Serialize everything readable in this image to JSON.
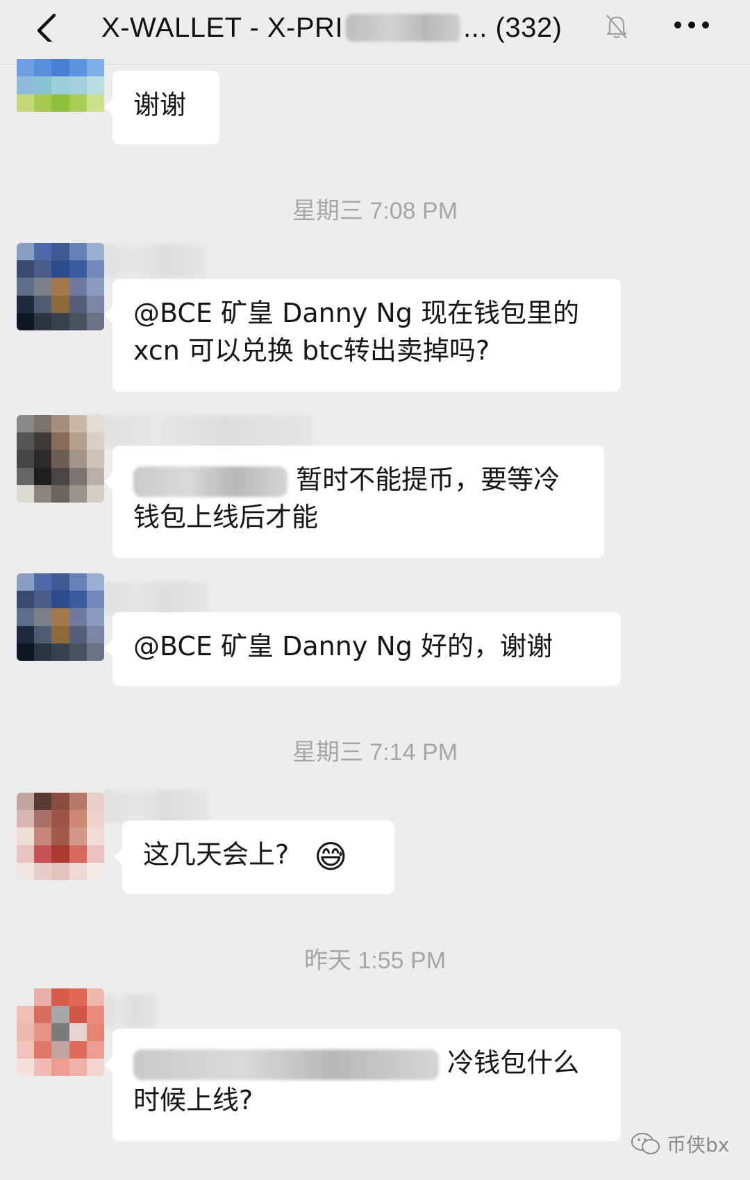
{
  "header": {
    "title_start": "X-WALLET - X-PRI",
    "title_end": "... (332)",
    "icons": {
      "back": "back-chevron-icon",
      "mute": "muted-bell-icon",
      "more": "more-dots-icon"
    }
  },
  "messages": [
    {
      "text": "谢谢"
    },
    {
      "text": "@BCE 矿皇 Danny Ng 现在钱包里的 xcn 可以兑换 btc转出卖掉吗?"
    },
    {
      "text_end": "暂时不能提币，要等冷钱包上线后才能"
    },
    {
      "text": "@BCE 矿皇 Danny Ng 好的，谢谢"
    },
    {
      "text": "这几天会上?",
      "emoji": "😅"
    },
    {
      "text_end": "冷钱包什么",
      "text_line2": "时候上线?"
    }
  ],
  "timestamps": [
    "星期三 7:08 PM",
    "星期三 7:14 PM",
    "昨天 1:55 PM"
  ],
  "watermark": {
    "text": "币侠bx",
    "icon": "wechat-icon"
  },
  "colors": {
    "background": "#ededed",
    "bubble": "#ffffff",
    "timestamp": "#a6a6a6"
  }
}
